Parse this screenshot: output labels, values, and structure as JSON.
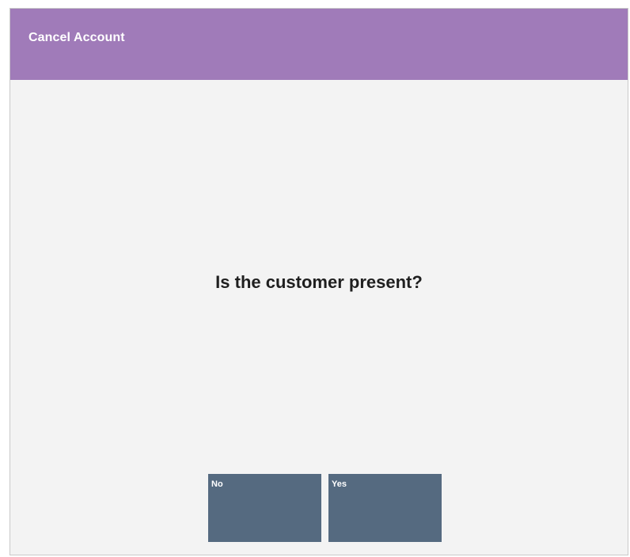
{
  "window": {
    "title": "Cancel Account",
    "accent_color": "#a07bb9"
  },
  "dialog": {
    "prompt": "Is the customer present?"
  },
  "buttons": {
    "no_label": "No",
    "yes_label": "Yes",
    "button_color": "#556a80"
  }
}
